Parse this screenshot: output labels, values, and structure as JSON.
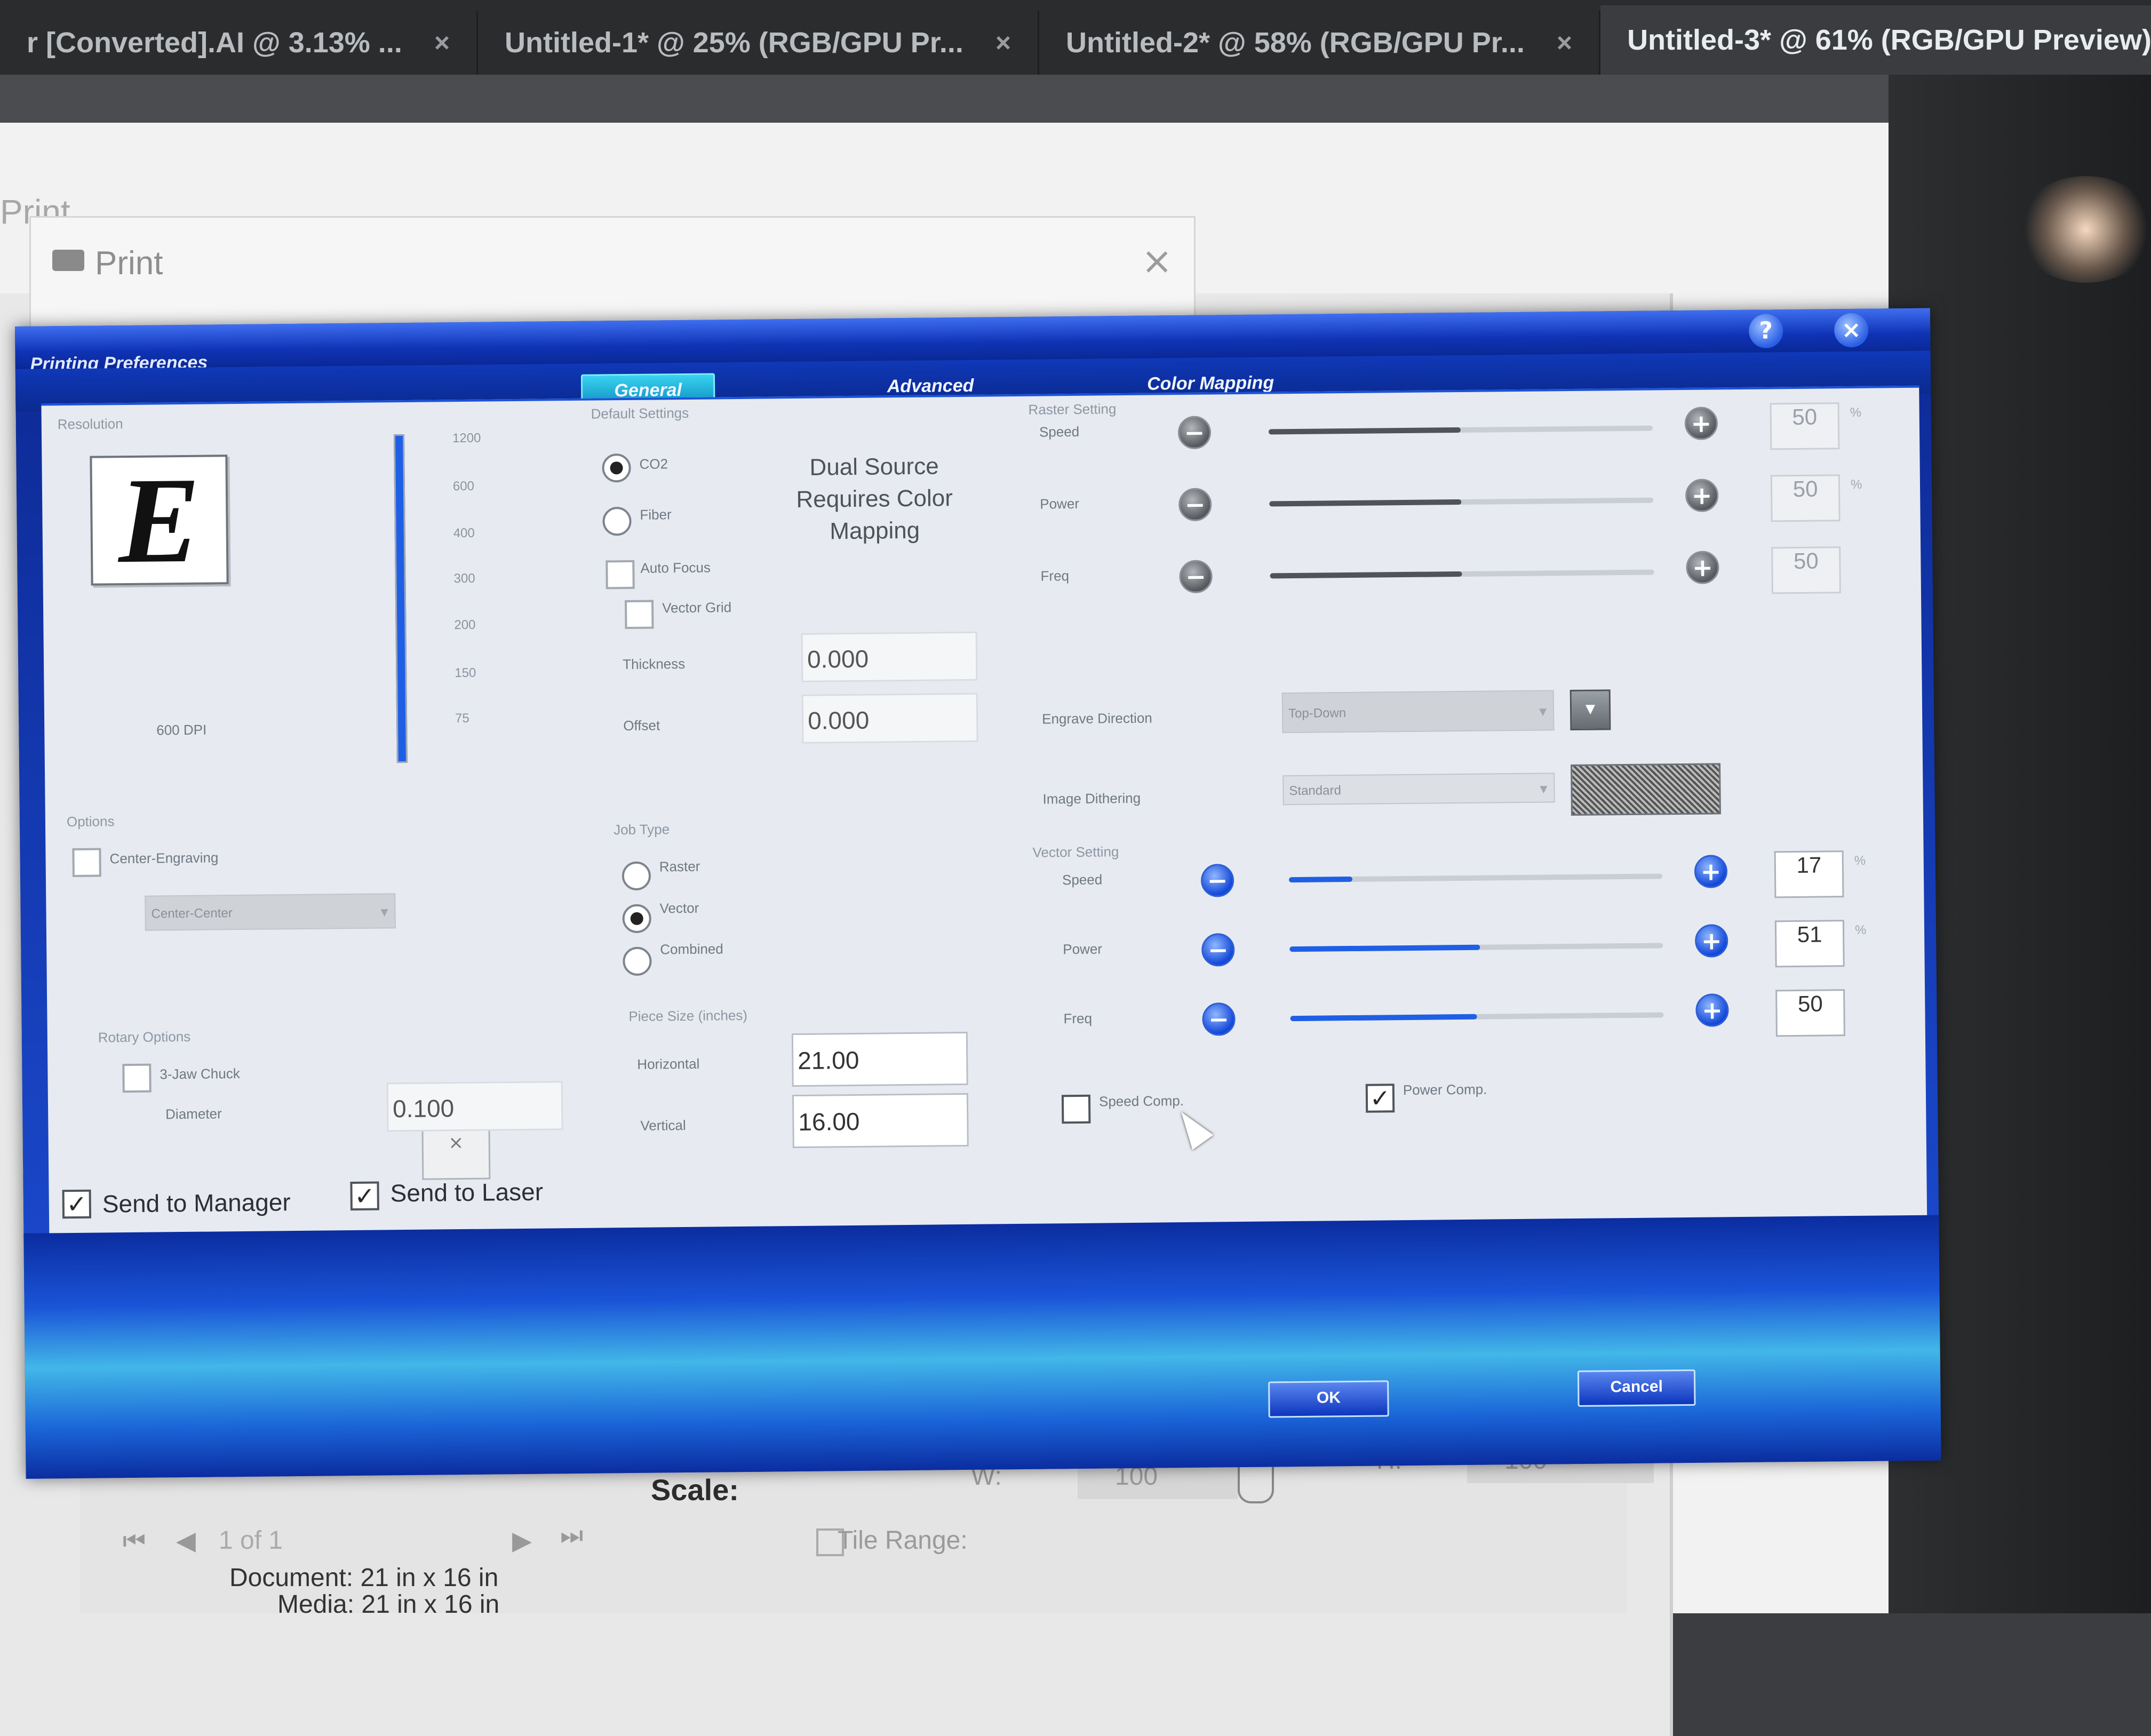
{
  "app": {
    "tabs": [
      {
        "label": "r [Converted].AI @ 3.13% ...",
        "active": false
      },
      {
        "label": "Untitled-1* @ 25% (RGB/GPU Pr...",
        "active": false
      },
      {
        "label": "Untitled-2* @ 58% (RGB/GPU Pr...",
        "active": false
      },
      {
        "label": "Untitled-3* @ 61% (RGB/GPU Preview)",
        "active": true
      }
    ],
    "close_glyph": "×"
  },
  "print_dialog": {
    "ghost_title": "Print",
    "title": "Print",
    "close_glyph": "×",
    "scale_label": "Scale:",
    "width_label": "W:",
    "width_value": "100",
    "height_label": "H:",
    "height_value": "100",
    "tile_range_label": "Tile Range:",
    "page_indicator": "1 of 1",
    "document_size": "Document: 21 in x 16 in",
    "media_size": "Media: 21 in x 16 in"
  },
  "prefs": {
    "title": "Printing Preferences",
    "help_glyph": "?",
    "close_glyph": "×",
    "tabs": [
      {
        "label": "General",
        "active": true
      },
      {
        "label": "Advanced",
        "active": false
      },
      {
        "label": "Color Mapping",
        "active": false
      }
    ],
    "resolution": {
      "label": "Resolution",
      "logo_letter": "E",
      "dpi_label": "600 DPI",
      "ticks": [
        "1200",
        "600",
        "400",
        "300",
        "200",
        "150",
        "75"
      ]
    },
    "default_settings": {
      "label": "Default Settings",
      "source_options": [
        {
          "label": "CO2",
          "selected": true
        },
        {
          "label": "Fiber",
          "selected": false
        }
      ],
      "auto_focus_label": "Auto Focus",
      "auto_focus_checked": false,
      "vector_grid_label": "Vector Grid",
      "vector_grid_checked": false,
      "dual_source_message": "Dual Source Requires Color Mapping",
      "thickness_label": "Thickness",
      "thickness_value": "0.000",
      "offset_label": "Offset",
      "offset_value": "0.000"
    },
    "options": {
      "label": "Options",
      "center_engraving_label": "Center-Engraving",
      "center_engraving_checked": false,
      "center_mode": "Center-Center"
    },
    "rotary": {
      "label": "Rotary Options",
      "chuck_label": "3-Jaw Chuck",
      "chuck_checked": false,
      "diameter_label": "Diameter",
      "diameter_value": "0.100"
    },
    "job_type": {
      "label": "Job Type",
      "options": [
        {
          "label": "Raster",
          "selected": false
        },
        {
          "label": "Vector",
          "selected": true
        },
        {
          "label": "Combined",
          "selected": false
        }
      ]
    },
    "piece_size": {
      "label": "Piece Size (inches)",
      "horizontal_label": "Horizontal",
      "horizontal_value": "21.00",
      "vertical_label": "Vertical",
      "vertical_value": "16.00"
    },
    "raster_setting": {
      "label": "Raster Setting",
      "rows": [
        {
          "label": "Speed",
          "value": "50",
          "unit": "%",
          "level_pct": 50
        },
        {
          "label": "Power",
          "value": "50",
          "unit": "%",
          "level_pct": 50
        },
        {
          "label": "Freq",
          "value": "50",
          "unit": "",
          "level_pct": 50
        }
      ],
      "engrave_direction_label": "Engrave Direction",
      "engrave_direction_value": "Top-Down",
      "image_dithering_label": "Image Dithering",
      "image_dithering_value": "Standard"
    },
    "vector_setting": {
      "label": "Vector Setting",
      "rows": [
        {
          "label": "Speed",
          "value": "17",
          "unit": "%",
          "level_pct": 17
        },
        {
          "label": "Power",
          "value": "51",
          "unit": "%",
          "level_pct": 51
        },
        {
          "label": "Freq",
          "value": "50",
          "unit": "",
          "level_pct": 50
        }
      ],
      "speed_comp_label": "Speed Comp.",
      "speed_comp_checked": false,
      "power_comp_label": "Power Comp.",
      "power_comp_checked": true
    },
    "send_to_manager_label": "Send to Manager",
    "send_to_manager_checked": true,
    "send_to_laser_label": "Send to Laser",
    "send_to_laser_checked": true,
    "ok_label": "OK",
    "cancel_label": "Cancel",
    "minus_glyph": "−",
    "plus_glyph": "+",
    "dropdown_glyph": "▾",
    "check_glyph": "✓"
  },
  "colors": {
    "dialog_blue": "#1742c8",
    "panel_bg": "#e7ebf1",
    "slider_blue": "#1f5fe6",
    "slider_gray": "#505459"
  }
}
